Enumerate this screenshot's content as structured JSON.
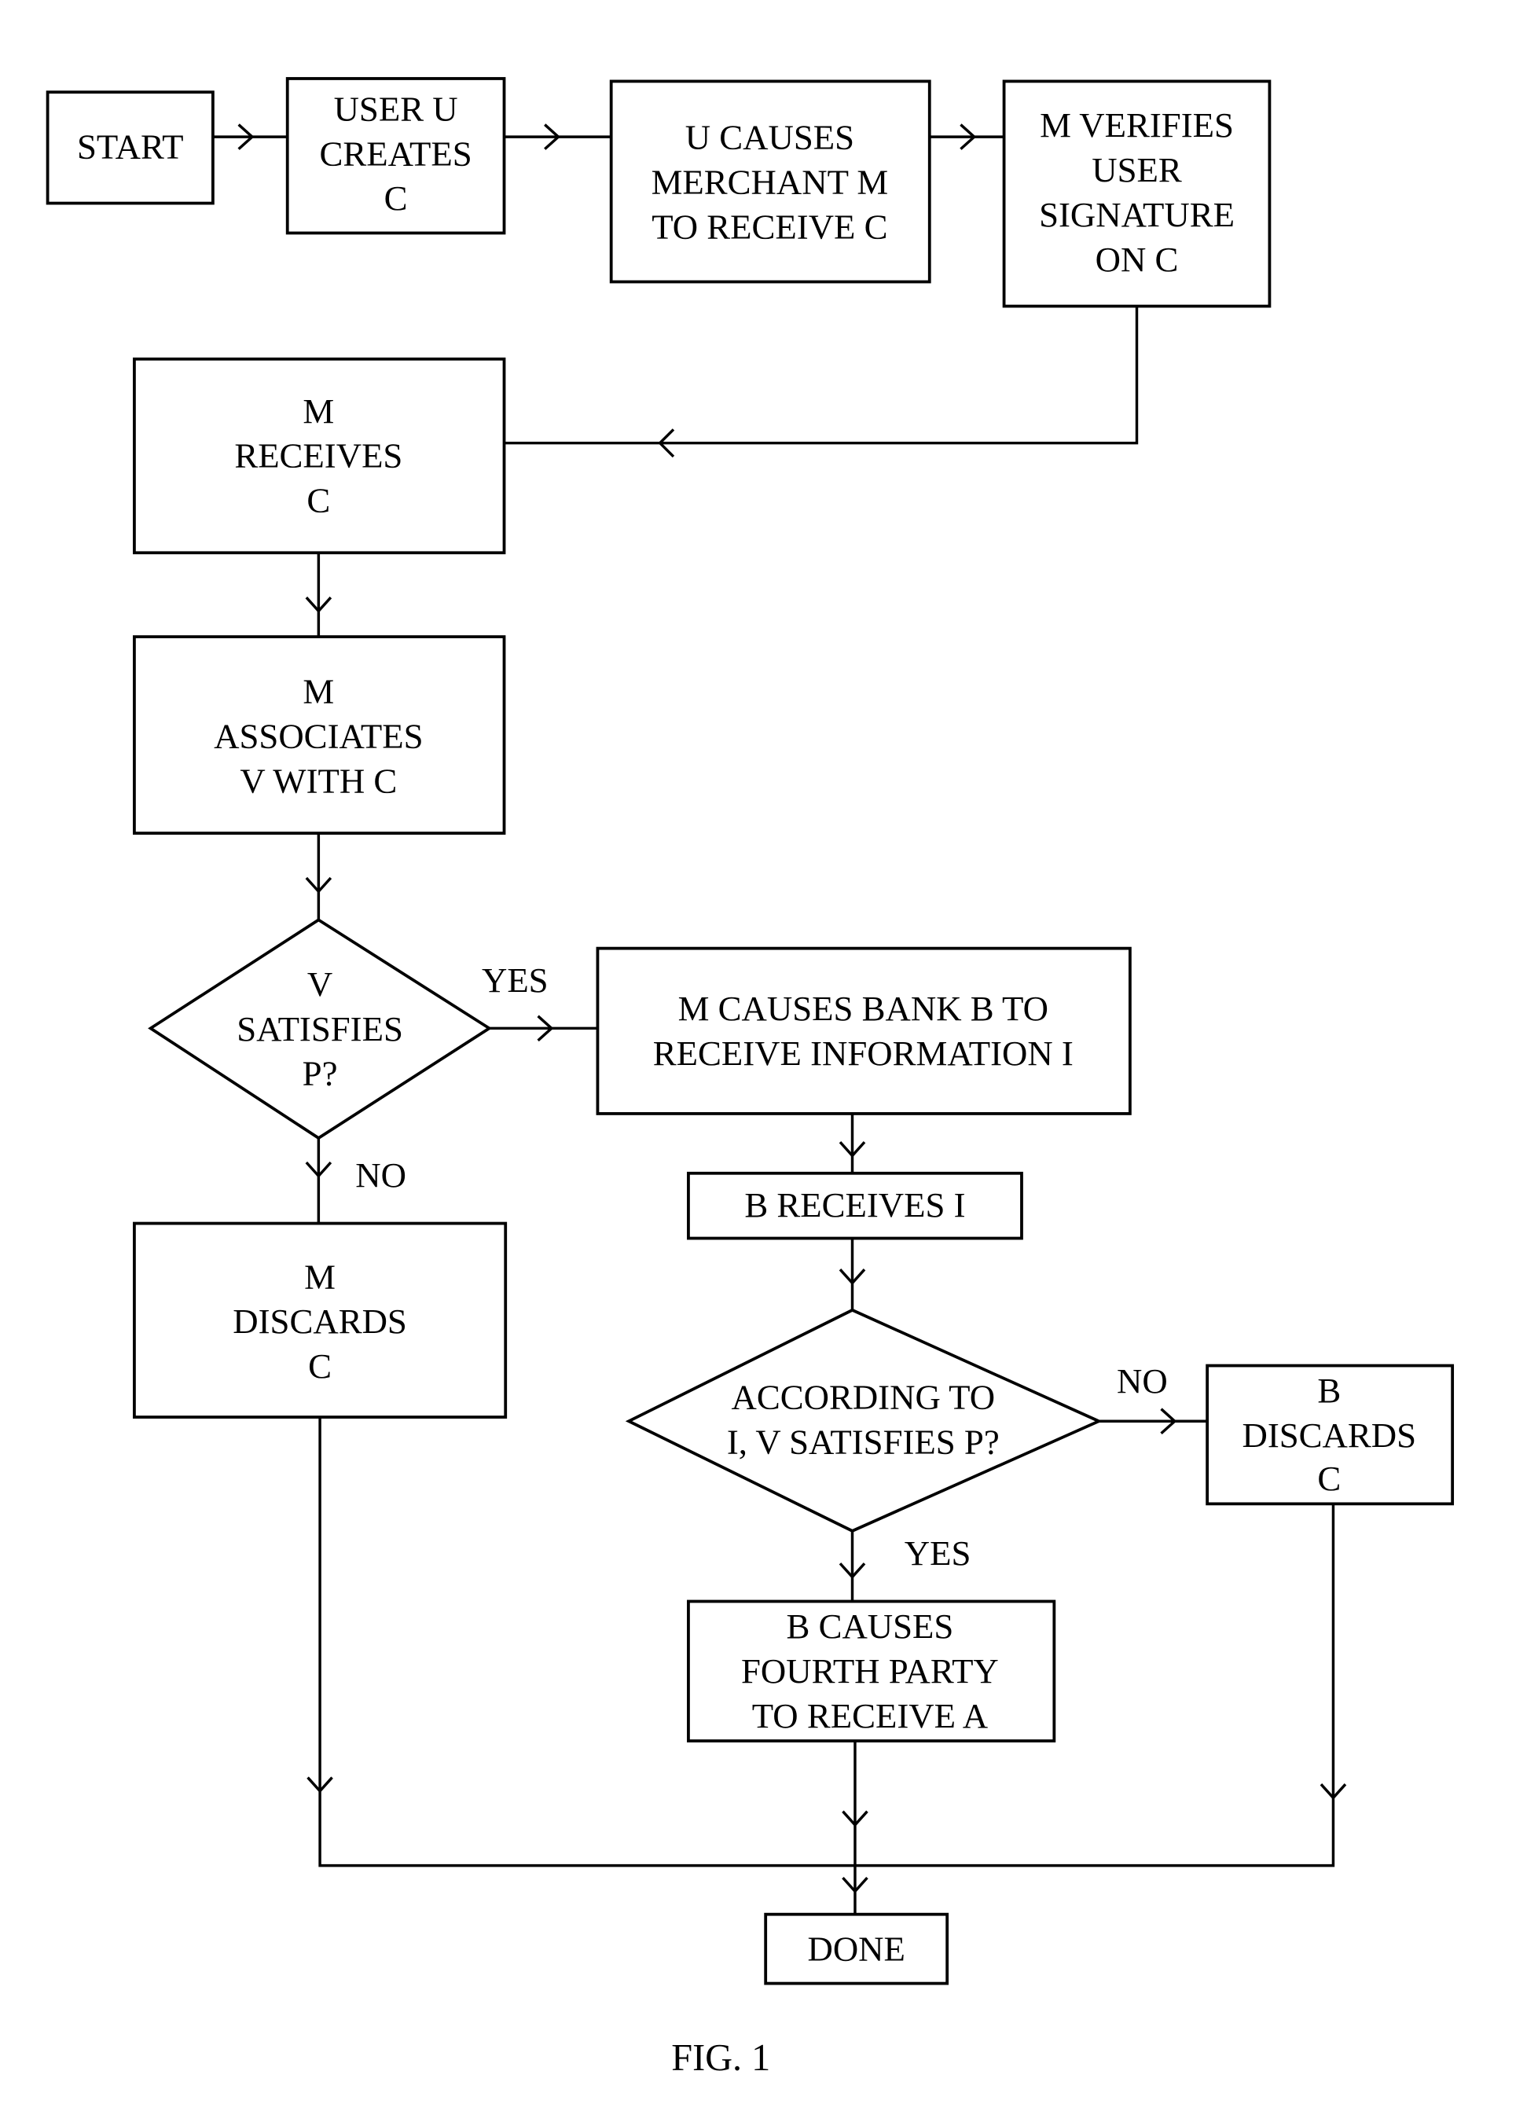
{
  "figure": {
    "caption": "FIG. 1",
    "nodes": {
      "start": {
        "type": "process",
        "lines": [
          "START"
        ]
      },
      "user_creates": {
        "type": "process",
        "lines": [
          "USER U",
          "CREATES",
          "C"
        ]
      },
      "u_causes": {
        "type": "process",
        "lines": [
          "U CAUSES",
          "MERCHANT M",
          "TO RECEIVE C"
        ]
      },
      "m_verifies": {
        "type": "process",
        "lines": [
          "M VERIFIES",
          "USER",
          "SIGNATURE",
          "ON C"
        ]
      },
      "m_receives": {
        "type": "process",
        "lines": [
          "M",
          "RECEIVES",
          "C"
        ]
      },
      "m_associates": {
        "type": "process",
        "lines": [
          "M",
          "ASSOCIATES",
          "V WITH C"
        ]
      },
      "v_satisfies": {
        "type": "decision",
        "lines": [
          "V",
          "SATISFIES",
          "P?"
        ]
      },
      "m_causes_bank": {
        "type": "process",
        "lines": [
          "M CAUSES BANK B TO",
          "RECEIVE INFORMATION I"
        ]
      },
      "b_receives": {
        "type": "process",
        "lines": [
          "B RECEIVES I"
        ]
      },
      "m_discards": {
        "type": "process",
        "lines": [
          "M",
          "DISCARDS",
          "C"
        ]
      },
      "according_to_i": {
        "type": "decision",
        "lines": [
          "ACCORDING TO",
          "I, V SATISFIES P?"
        ]
      },
      "b_discards": {
        "type": "process",
        "lines": [
          "B",
          "DISCARDS",
          "C"
        ]
      },
      "b_causes_fourth": {
        "type": "process",
        "lines": [
          "B CAUSES",
          "FOURTH PARTY",
          "TO RECEIVE A"
        ]
      },
      "done": {
        "type": "process",
        "lines": [
          "DONE"
        ]
      }
    },
    "edge_labels": {
      "v_yes": "YES",
      "v_no": "NO",
      "i_no": "NO",
      "i_yes": "YES"
    }
  }
}
